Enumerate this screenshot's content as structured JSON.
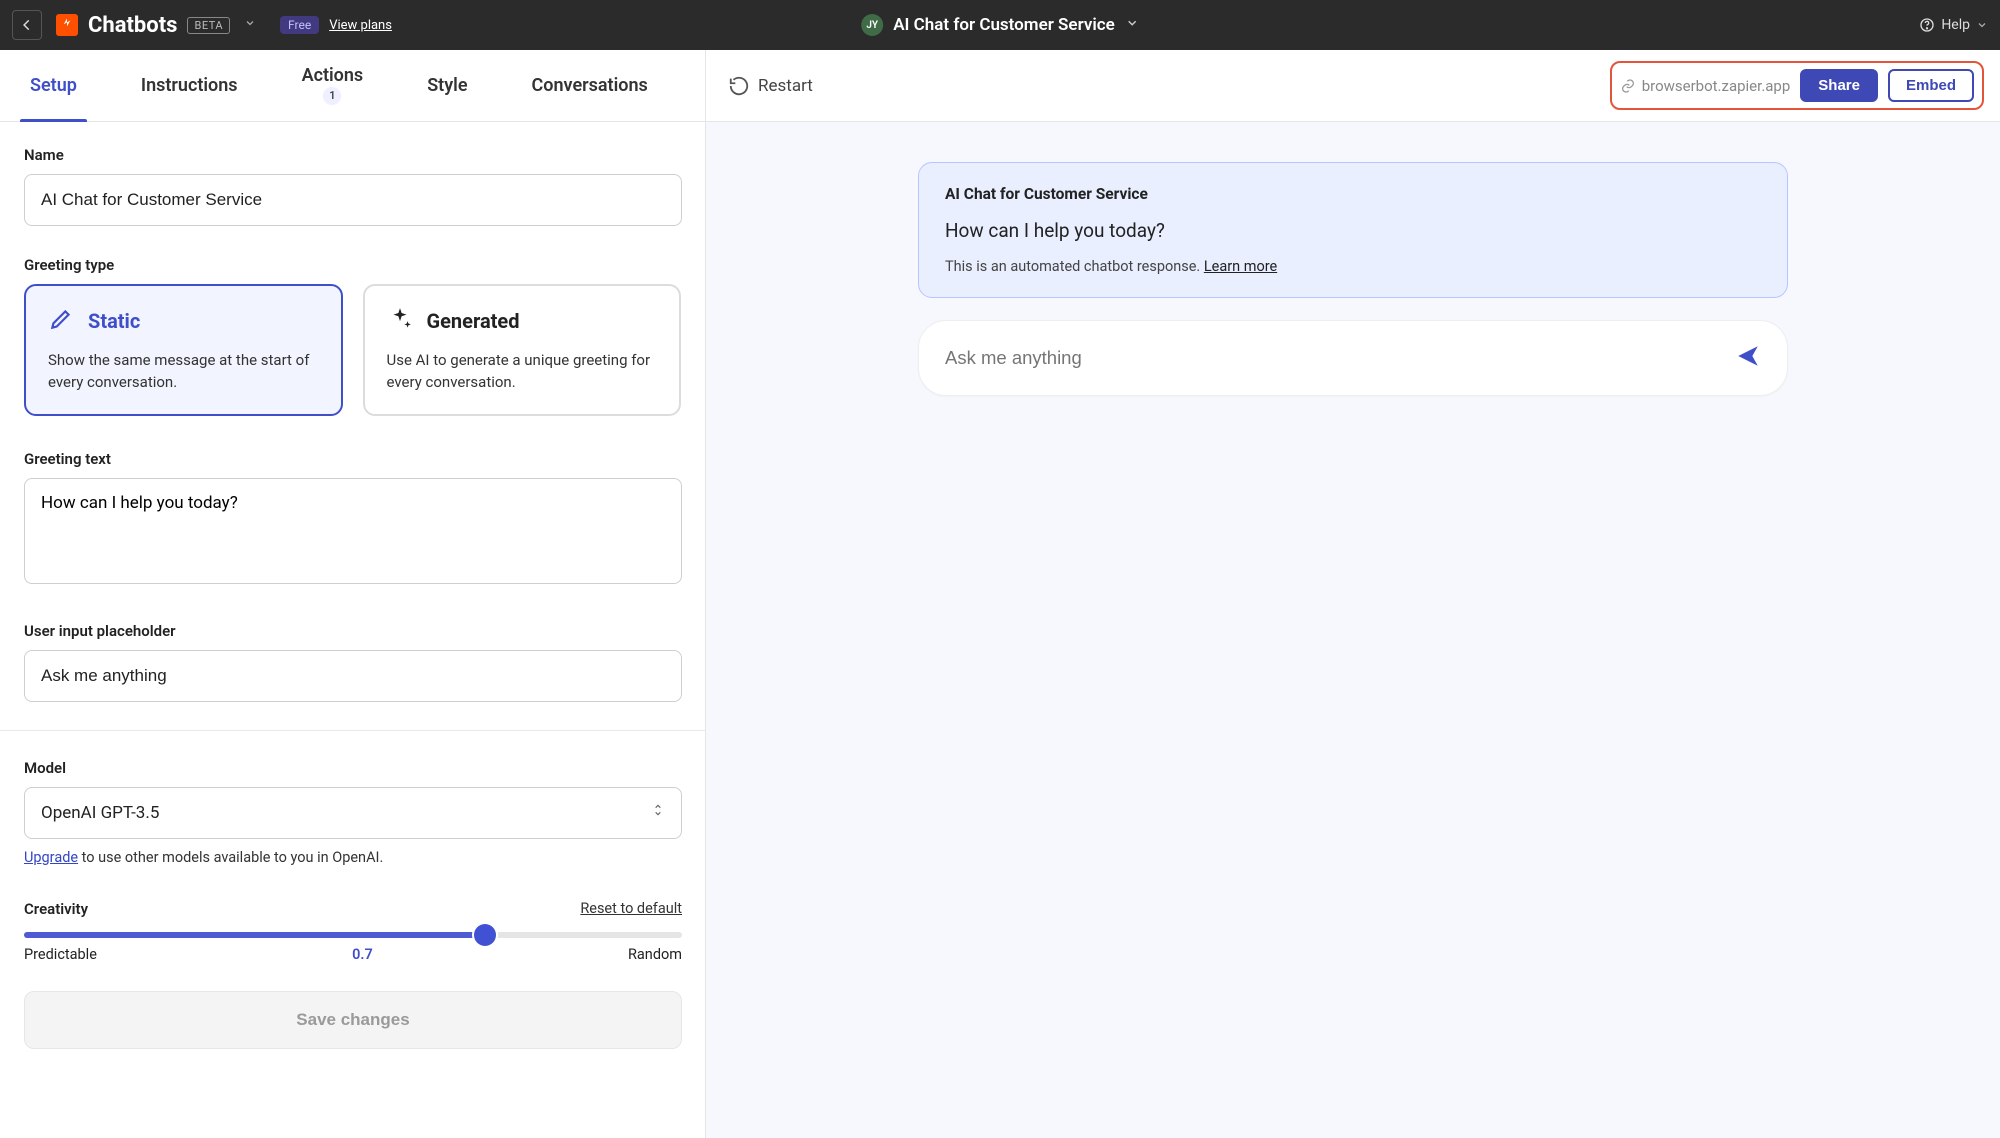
{
  "topbar": {
    "brand": "Chatbots",
    "beta": "BETA",
    "plan_chip": "Free",
    "view_plans": "View plans",
    "avatar_initials": "JY",
    "doc_title": "AI Chat for Customer Service",
    "help": "Help"
  },
  "tabs": {
    "setup": "Setup",
    "instructions": "Instructions",
    "actions": "Actions",
    "actions_count": "1",
    "style": "Style",
    "conversations": "Conversations",
    "active": "setup"
  },
  "subbar": {
    "restart": "Restart",
    "bot_url": "browserbot.zapier.app",
    "share": "Share",
    "embed": "Embed"
  },
  "form": {
    "name_label": "Name",
    "name_value": "AI Chat for Customer Service",
    "greeting_type_label": "Greeting type",
    "static": {
      "title": "Static",
      "desc": "Show the same message at the start of every conversation."
    },
    "generated": {
      "title": "Generated",
      "desc": "Use AI to generate a unique greeting for every conversation."
    },
    "greeting_text_label": "Greeting text",
    "greeting_text_value": "How can I help you today?",
    "placeholder_label": "User input placeholder",
    "placeholder_value": "Ask me anything",
    "model_label": "Model",
    "model_value": "OpenAI GPT-3.5",
    "upgrade_link": "Upgrade",
    "upgrade_rest": " to use other models available to you in OpenAI.",
    "creativity_label": "Creativity",
    "reset": "Reset to default",
    "slider_min": "Predictable",
    "slider_val": "0.7",
    "slider_max": "Random",
    "save": "Save changes"
  },
  "preview": {
    "bot_name": "AI Chat for Customer Service",
    "greeting": "How can I help you today?",
    "footnote_text": "This is an automated chatbot response. ",
    "footnote_link": "Learn more",
    "input_placeholder": "Ask me anything"
  }
}
